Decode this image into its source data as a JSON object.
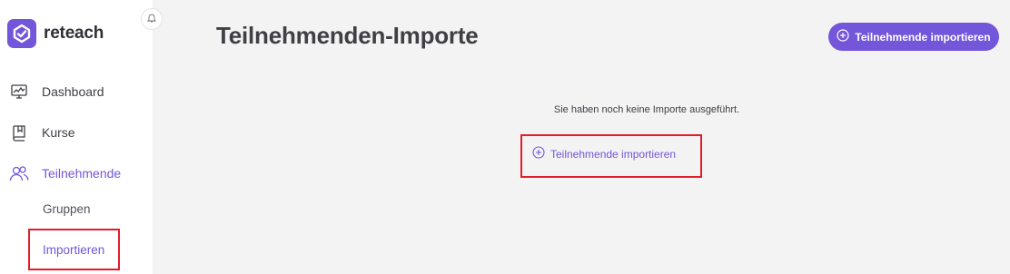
{
  "brand": {
    "name": "reteach",
    "color": "#7356d9"
  },
  "sidebar": {
    "items": [
      {
        "label": "Dashboard",
        "icon": "dashboard-monitor-icon"
      },
      {
        "label": "Kurse",
        "icon": "book-icon"
      },
      {
        "label": "Teilnehmende",
        "icon": "users-icon",
        "active": true
      }
    ],
    "subitems": [
      {
        "label": "Gruppen"
      },
      {
        "label": "Importieren",
        "active": true
      }
    ]
  },
  "header": {
    "notification_icon": "bell-icon",
    "title": "Teilnehmenden-Importe",
    "import_button_label": "Teilnehmende importieren"
  },
  "main": {
    "empty_message": "Sie haben noch keine Importe ausgeführt.",
    "import_link_label": "Teilnehmende importieren"
  },
  "highlight_color": "#e11d2b"
}
